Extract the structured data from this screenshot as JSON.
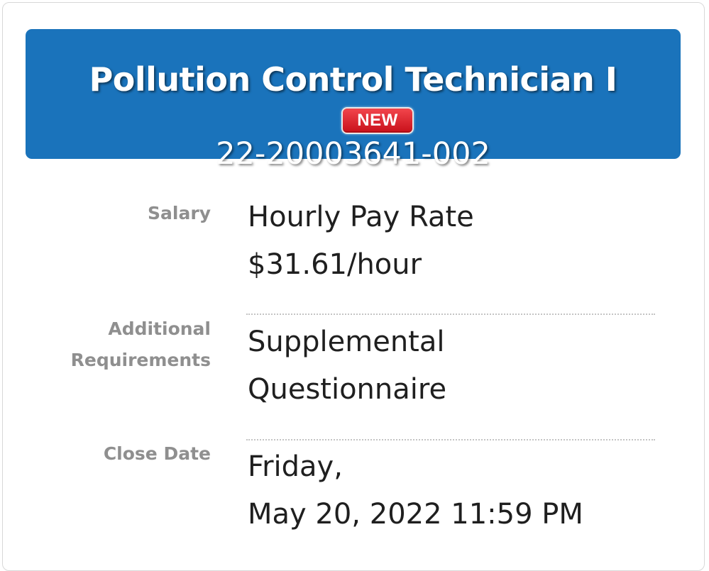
{
  "job": {
    "title": "Pollution Control Technician I",
    "badge": "NEW",
    "number": "22-20003641-002"
  },
  "details": {
    "salary": {
      "label": "Salary",
      "line1": "Hourly Pay Rate",
      "line2": "$31.61/hour"
    },
    "additional_requirements": {
      "label_line1": "Additional",
      "label_line2": "Requirements",
      "line1": "Supplemental",
      "line2": "Questionnaire"
    },
    "close_date": {
      "label": "Close Date",
      "line1": "Friday,",
      "line2": "May 20, 2022 11:59 PM"
    }
  },
  "colors": {
    "header_background": "#1a73bb",
    "badge_background": "#d9232b",
    "label_text": "#8f8f8f",
    "value_text": "#1f1f1f"
  }
}
